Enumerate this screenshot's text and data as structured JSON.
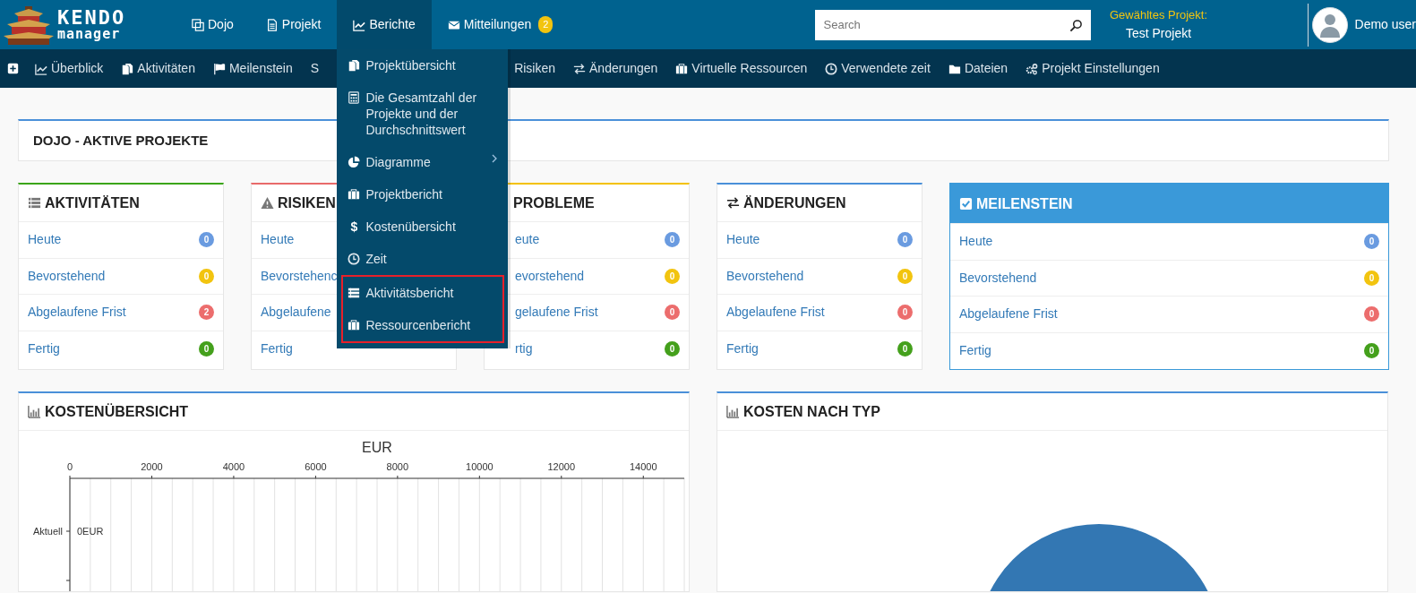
{
  "logo": {
    "line1": "KENDO",
    "line2": "manager"
  },
  "topnav": [
    {
      "label": "Dojo",
      "selected": false
    },
    {
      "label": "Projekt",
      "selected": false
    },
    {
      "label": "Berichte",
      "selected": true
    },
    {
      "label": "Mitteilungen",
      "selected": false,
      "badge": "2"
    }
  ],
  "search": {
    "placeholder": "Search"
  },
  "project": {
    "caption": "Gewähltes Projekt:",
    "name": "Test Projekt"
  },
  "user": {
    "name": "Demo user"
  },
  "subnav": [
    "Überblick",
    "Aktivitäten",
    "Meilenstein",
    "S",
    "Risiken",
    "Änderungen",
    "Virtuelle Ressourcen",
    "Verwendete zeit",
    "Dateien",
    "Projekt Einstellungen"
  ],
  "dropdown": [
    {
      "label": "Projektübersicht",
      "highlighted": false
    },
    {
      "label": "Die Gesamtzahl der Projekte und der Durchschnittswert",
      "highlighted": false
    },
    {
      "label": "Diagramme",
      "highlighted": false,
      "submenu": true
    },
    {
      "label": "Projektbericht",
      "highlighted": false
    },
    {
      "label": "Kostenübersicht",
      "highlighted": false,
      "symbol": "$"
    },
    {
      "label": "Zeit",
      "highlighted": false
    },
    {
      "label": "Aktivitätsbericht",
      "highlighted": true
    },
    {
      "label": "Ressourcenbericht",
      "highlighted": true
    }
  ],
  "panel_title": "DOJO - AKTIVE PROJEKTE",
  "cards": [
    {
      "title": "AKTIVITÄTEN",
      "color": "#3ba516",
      "highlighted": false,
      "rows": [
        {
          "label": "Heute",
          "count": "0",
          "color": "#6a9be0"
        },
        {
          "label": "Bevorstehend",
          "count": "0",
          "color": "#f2c40f"
        },
        {
          "label": "Abgelaufene Frist",
          "count": "2",
          "color": "#ec6d6d"
        },
        {
          "label": "Fertig",
          "count": "0",
          "color": "#44a01c"
        }
      ]
    },
    {
      "title": "RISIKEN",
      "color": "#e86a6a",
      "highlighted": false,
      "rows": [
        {
          "label": "Heute"
        },
        {
          "label": "Bevorstehenc"
        },
        {
          "label": "Abgelaufene"
        },
        {
          "label": "Fertig"
        }
      ]
    },
    {
      "title": "PROBLEME",
      "color": "#f3c200",
      "highlighted": false,
      "rows": [
        {
          "label": "eute",
          "count": "0",
          "color": "#6a9be0"
        },
        {
          "label": "evorstehend",
          "count": "0",
          "color": "#f2c40f"
        },
        {
          "label": "gelaufene Frist",
          "count": "0",
          "color": "#ec6d6d"
        },
        {
          "label": "rtig",
          "count": "0",
          "color": "#44a01c"
        }
      ]
    },
    {
      "title": "ÄNDERUNGEN",
      "color": "#4a90d9",
      "highlighted": false,
      "rows": [
        {
          "label": "Heute",
          "count": "0",
          "color": "#6a9be0"
        },
        {
          "label": "Bevorstehend",
          "count": "0",
          "color": "#f2c40f"
        },
        {
          "label": "Abgelaufene Frist",
          "count": "0",
          "color": "#ec6d6d"
        },
        {
          "label": "Fertig",
          "count": "0",
          "color": "#44a01c"
        }
      ]
    },
    {
      "title": "MEILENSTEIN",
      "color": "#3a99d9",
      "highlighted": true,
      "rows": [
        {
          "label": "Heute",
          "count": "0",
          "color": "#6a9be0"
        },
        {
          "label": "Bevorstehend",
          "count": "0",
          "color": "#f2c40f"
        },
        {
          "label": "Abgelaufene Frist",
          "count": "0",
          "color": "#ec6d6d"
        },
        {
          "label": "Fertig",
          "count": "0",
          "color": "#44a01c"
        }
      ]
    }
  ],
  "cost_overview": {
    "title": "KOSTENÜBERSICHT",
    "chart_data": {
      "type": "bar",
      "orientation": "horizontal",
      "title": "EUR",
      "categories": [
        "Aktuell"
      ],
      "values": [
        0
      ],
      "xlim": [
        0,
        15000
      ],
      "xticks": [
        0,
        2000,
        4000,
        6000,
        8000,
        10000,
        12000,
        14000
      ],
      "value_labels": [
        "0EUR"
      ],
      "grid": true
    }
  },
  "cost_by_type": {
    "title": "KOSTEN NACH TYP"
  }
}
